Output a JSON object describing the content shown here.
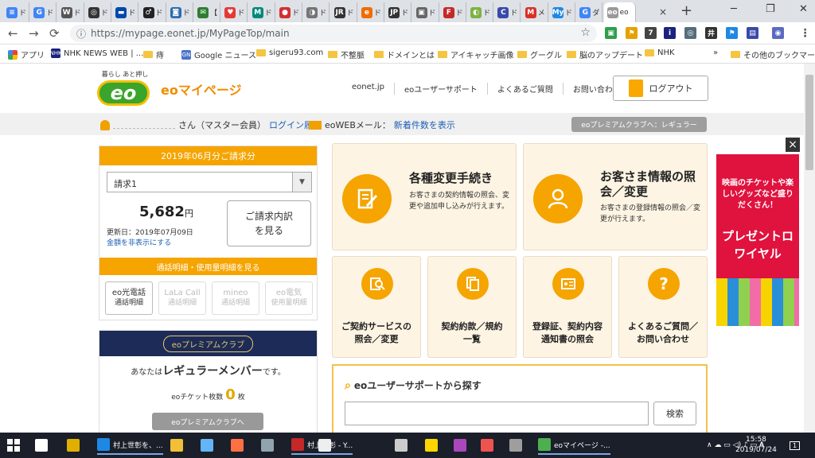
{
  "browser": {
    "tabs": [
      {
        "label": "ド",
        "icon_letter": "≡",
        "color": "#4285f4"
      },
      {
        "label": "ド",
        "icon_letter": "G",
        "color": "#4285f4"
      },
      {
        "label": "ド",
        "icon_letter": "W",
        "color": "#555555"
      },
      {
        "label": "ド",
        "icon_letter": "◎",
        "color": "#333333"
      },
      {
        "label": "ド",
        "icon_letter": "▬",
        "color": "#0047ab"
      },
      {
        "label": "ド",
        "icon_letter": "♂",
        "color": "#222222"
      },
      {
        "label": "ド",
        "icon_letter": "◙",
        "color": "#2b6cb0"
      },
      {
        "label": "【",
        "icon_letter": "✉",
        "color": "#2e7d32"
      },
      {
        "label": "ド",
        "icon_letter": "♥",
        "color": "#e53935"
      },
      {
        "label": "ド",
        "icon_letter": "M",
        "color": "#00897b"
      },
      {
        "label": "ド",
        "icon_letter": "●",
        "color": "#d32f2f"
      },
      {
        "label": "ド",
        "icon_letter": "◑",
        "color": "#757575"
      },
      {
        "label": "ド",
        "icon_letter": "JR",
        "color": "#333333"
      },
      {
        "label": "ド",
        "icon_letter": "e",
        "color": "#ef6c00"
      },
      {
        "label": "ド",
        "icon_letter": "JP",
        "color": "#333333"
      },
      {
        "label": "ド",
        "icon_letter": "▣",
        "color": "#666666"
      },
      {
        "label": "ド",
        "icon_letter": "F",
        "color": "#c62828"
      },
      {
        "label": "ド",
        "icon_letter": "◐",
        "color": "#7cb342"
      },
      {
        "label": "ド",
        "icon_letter": "C",
        "color": "#3949ab"
      },
      {
        "label": "メ",
        "icon_letter": "M",
        "color": "#d93025"
      },
      {
        "label": "ド",
        "icon_letter": "My",
        "color": "#1e88e5"
      },
      {
        "label": "ダ",
        "icon_letter": "G",
        "color": "#4285f4"
      },
      {
        "label": "eo",
        "icon_letter": "eo",
        "color": "#999999"
      }
    ],
    "active_tab_close": "×",
    "new_tab": "+",
    "window_controls": [
      "─",
      "❐",
      "✕"
    ],
    "url": "https://mypage.eonet.jp/MyPageTop/main",
    "nav": {
      "back": "←",
      "forward": "→",
      "reload": "⟳"
    },
    "star": "☆",
    "extensions": [
      {
        "label": "▣",
        "color": "#2e9f4a"
      },
      {
        "label": "⚑",
        "color": "#e5a100"
      },
      {
        "label": "7",
        "color": "#444444"
      },
      {
        "label": "i",
        "color": "#1a237e"
      },
      {
        "label": "◎",
        "color": "#546e7a"
      },
      {
        "label": "井",
        "color": "#333333"
      },
      {
        "label": "⚑",
        "color": "#1e88e5"
      },
      {
        "label": "▤",
        "color": "#3949ab"
      },
      {
        "label": "◉",
        "color": "#5c6bc0"
      },
      {
        "label": "⋮",
        "color": "#666666"
      }
    ],
    "bookmarks": [
      {
        "label": "アプリ",
        "kind": "apps"
      },
      {
        "label": "NHK NEWS WEB | ...",
        "kind": "site",
        "icon": "NHK",
        "color": "#1a237e"
      },
      {
        "label": "痔",
        "kind": "folder"
      },
      {
        "label": "Google ニュース",
        "kind": "site",
        "icon": "GN",
        "color": "#4a73c9"
      },
      {
        "label": "sigeru93.com",
        "kind": "folder"
      },
      {
        "label": "不整脈",
        "kind": "folder"
      },
      {
        "label": "ドメインとは",
        "kind": "folder"
      },
      {
        "label": "アイキャッチ画像",
        "kind": "folder"
      },
      {
        "label": "グーグル",
        "kind": "folder"
      },
      {
        "label": "脳のアップデート",
        "kind": "folder"
      },
      {
        "label": "NHK",
        "kind": "folder"
      }
    ],
    "bookmarks_more": "»",
    "other_bookmarks": "その他のブックマーク"
  },
  "site": {
    "logo_tagline": "暮らし あと押し",
    "logo_mark": "eo",
    "title": "eoマイページ",
    "topnav": [
      "eonet.jp",
      "eoユーザーサポート",
      "よくあるご質問",
      "お問い合わせ"
    ],
    "logout": "ログアウト"
  },
  "infobar": {
    "user_suffix": "さん（マスター会員）",
    "login_history": "ログイン履歴",
    "mail_label": "eoWEBメール：",
    "new_mail": "新着件数を表示",
    "premium_link": "eoプレミアムクラブへ：レギュラー"
  },
  "billing": {
    "header": "2019年06月分ご請求分",
    "select_value": "請求1",
    "amount": "5,682",
    "currency": "円",
    "updated": "更新日：2019年07月09日",
    "hide_amount": "金額を非表示にする",
    "detail_button": "ご請求内訳を見る",
    "calls_header": "通話明細・使用量明細を見る",
    "services": [
      {
        "name": "eo光電話",
        "sub": "通話明細",
        "enabled": true
      },
      {
        "name": "LaLa Call",
        "sub": "通話明細",
        "enabled": false
      },
      {
        "name": "mineo",
        "sub": "通話明細",
        "enabled": false
      },
      {
        "name": "eo電気",
        "sub": "使用量明細",
        "enabled": false
      }
    ]
  },
  "premium": {
    "header": "eoプレミアムクラブ",
    "member_prefix": "あなたは",
    "member_rank": "レギュラーメンバー",
    "member_suffix": "です。",
    "tickets_label": "eoチケット枚数",
    "tickets_count": "0",
    "tickets_unit": "枚",
    "button": "eoプレミアムクラブへ"
  },
  "cards": {
    "change": {
      "title": "各種変更手続き",
      "desc": "お客さまの契約情報の照会、変更や追加申し込みが行えます。"
    },
    "customer": {
      "title": "お客さま情報の照会／変更",
      "desc": "お客さまの登録情報の照会／変更が行えます。"
    },
    "small": [
      {
        "label": "ご契約サービスの照会／変更",
        "icon": "search"
      },
      {
        "label": "契約約款／規約一覧",
        "icon": "docs"
      },
      {
        "label": "登録証、契約内容通知書の照会",
        "icon": "card"
      },
      {
        "label": "よくあるご質問／お問い合わせ",
        "icon": "question"
      }
    ]
  },
  "search": {
    "title": "eoユーザーサポートから探す",
    "button": "検索",
    "placeholder": ""
  },
  "ad": {
    "close": "×",
    "line1": "映画のチケットや楽しいグッズなど盛りだくさん！",
    "line2": "プレゼントロワイヤル"
  },
  "taskbar": {
    "items": [
      {
        "label": "",
        "color": "#ffffff"
      },
      {
        "label": "",
        "color": "#e0b000"
      },
      {
        "label": "",
        "color": "#2b78e4"
      },
      {
        "label": "村上世彰を、...",
        "color": "#1e88e5",
        "open": true
      },
      {
        "label": "",
        "color": "#f2c037"
      },
      {
        "label": "",
        "color": "#64b5f6"
      },
      {
        "label": "",
        "color": "#ff7043"
      },
      {
        "label": "",
        "color": "#90a4ae"
      },
      {
        "label": "村上世彰 - Y...",
        "color": "#c62828",
        "open": true
      },
      {
        "label": "",
        "color": "#eeeeee"
      },
      {
        "label": "",
        "color": "#cccccc"
      },
      {
        "label": "",
        "color": "#ffd600"
      },
      {
        "label": "",
        "color": "#ab47bc"
      },
      {
        "label": "",
        "color": "#ef5350"
      },
      {
        "label": "",
        "color": "#9e9e9e"
      },
      {
        "label": "eoマイページ -...",
        "color": "#4caf50",
        "open": true
      }
    ],
    "tray": "∧ ☁ ▭ ◁) ♪ ▭ 𝐀",
    "time": "15:58",
    "date": "2019/07/24",
    "notify": "1"
  }
}
